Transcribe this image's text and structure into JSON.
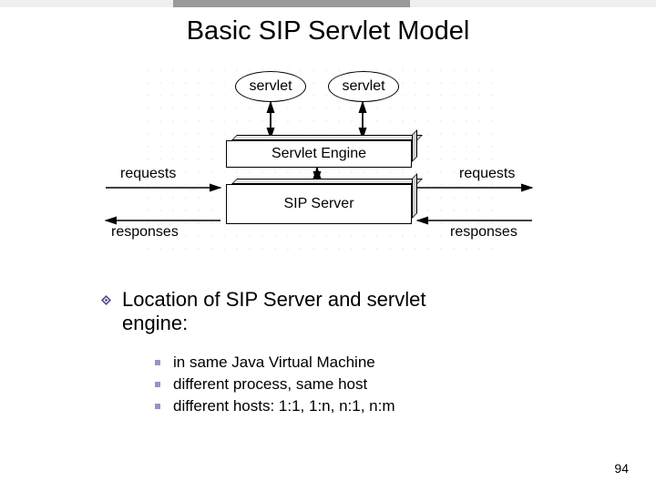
{
  "title": "Basic SIP Servlet Model",
  "diagram": {
    "servlet1": "servlet",
    "servlet2": "servlet",
    "engine": "Servlet Engine",
    "server": "SIP Server",
    "requests_left": "requests",
    "responses_left": "responses",
    "requests_right": "requests",
    "responses_right": "responses"
  },
  "bullet_main_line1": "Location of SIP Server and servlet",
  "bullet_main_line2": "engine:",
  "subs": [
    "in same Java Virtual Machine",
    "different process, same host",
    "different hosts: 1:1, 1:n, n:1, n:m"
  ],
  "page": "94"
}
